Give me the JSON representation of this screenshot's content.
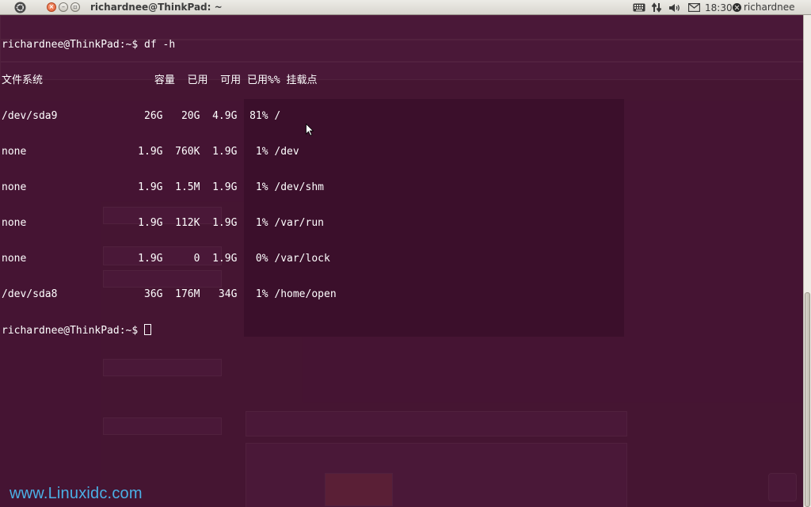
{
  "panel": {
    "window_title": "richardnee@ThinkPad: ~",
    "clock": "18:30",
    "username": "richardnee",
    "icons": [
      "ubuntu-logo-icon",
      "keyboard-icon",
      "network-icon",
      "volume-icon",
      "mail-icon",
      "power-icon"
    ]
  },
  "terminal": {
    "lines": [
      "richardnee@ThinkPad:~$ df -h",
      "文件系统                  容量  已用  可用 已用%% 挂载点",
      "/dev/sda9              26G   20G  4.9G  81% /",
      "none                  1.9G  760K  1.9G   1% /dev",
      "none                  1.9G  1.5M  1.9G   1% /dev/shm",
      "none                  1.9G  112K  1.9G   1% /var/run",
      "none                  1.9G     0  1.9G   0% /var/lock",
      "/dev/sda8              36G  176M   34G   1% /home/open",
      "richardnee@ThinkPad:~$ "
    ]
  },
  "watermark": "www.Linuxidc.com",
  "colors": {
    "terminal_bg": "#3b0f2a",
    "terminal_fg": "#ffffff",
    "panel_bg": "#dfddd6",
    "watermark": "#4bb0e6"
  }
}
